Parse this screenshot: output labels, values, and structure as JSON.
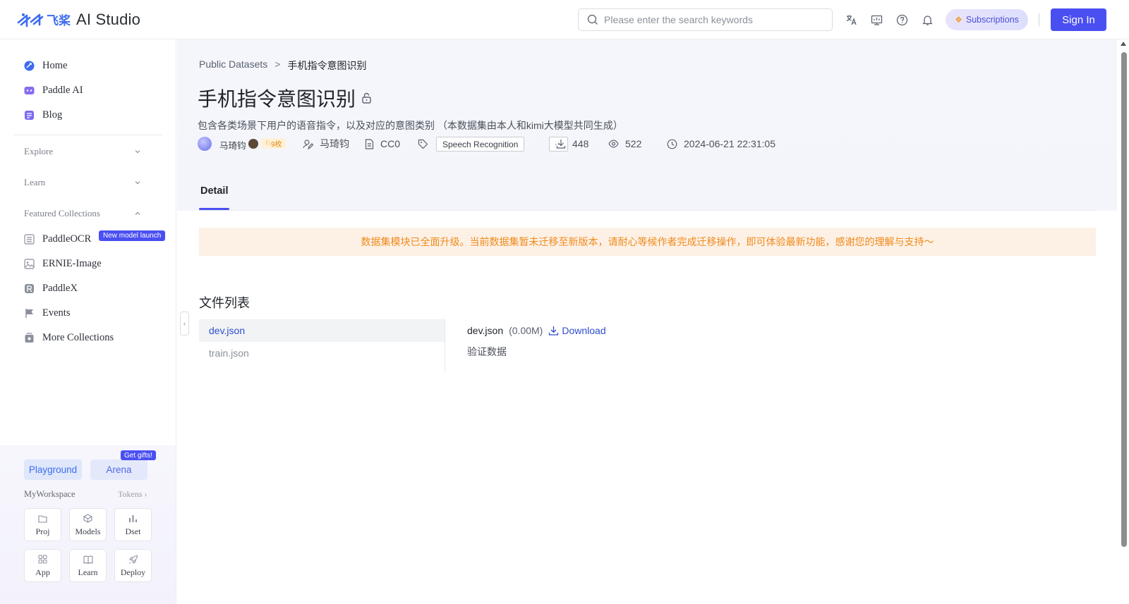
{
  "header": {
    "logo_text": "AI Studio",
    "logo_cn": "飞桨",
    "search_placeholder": "Please enter the search keywords",
    "icons": [
      "translate-icon",
      "monitor-icon",
      "help-icon",
      "bell-icon"
    ],
    "subscriptions_label": "Subscriptions",
    "signin_label": "Sign In"
  },
  "sidebar": {
    "items": [
      {
        "label": "Home",
        "icon": "home-icon",
        "color": "#3d6cf0"
      },
      {
        "label": "Paddle AI",
        "icon": "paddle-ai-icon",
        "color": "#8b6cf0"
      },
      {
        "label": "Blog",
        "icon": "blog-icon",
        "color": "#7a6cf0"
      }
    ],
    "sections": [
      {
        "label": "Explore",
        "expanded": false
      },
      {
        "label": "Learn",
        "expanded": false
      },
      {
        "label": "Featured Collections",
        "expanded": true
      }
    ],
    "collections": [
      {
        "label": "PaddleOCR",
        "icon": "ocr-icon",
        "badge": "New model launch"
      },
      {
        "label": "ERNIE-Image",
        "icon": "image-icon"
      },
      {
        "label": "PaddleX",
        "icon": "paddlex-icon"
      },
      {
        "label": "Events",
        "icon": "flag-icon"
      },
      {
        "label": "More Collections",
        "icon": "collections-icon"
      }
    ],
    "bottom": {
      "playground_label": "Playground",
      "arena_label": "Arena",
      "gifts_label": "Get gifts!",
      "workspace_title": "MyWorkspace",
      "tokens_label": "Tokens",
      "tiles": [
        {
          "label": "Proj",
          "icon": "folder-icon"
        },
        {
          "label": "Models",
          "icon": "cube-icon"
        },
        {
          "label": "Dset",
          "icon": "dataset-icon"
        },
        {
          "label": "App",
          "icon": "apps-icon"
        },
        {
          "label": "Learn",
          "icon": "book-icon"
        },
        {
          "label": "Deploy",
          "icon": "rocket-icon"
        }
      ]
    }
  },
  "main": {
    "breadcrumb": {
      "parent": "Public Datasets",
      "separator": ">",
      "current": "手机指令意图识别"
    },
    "title": "手机指令意图识别",
    "description": "包含各类场景下用户的语音指令，以及对应的意图类别 （本数据集由本人和kimi大模型共同生成）",
    "meta": {
      "author": "马琦钧",
      "medal": "9枚",
      "contributor": "马琦钧",
      "license": "CC0",
      "tag": "Speech Recognition",
      "tag_more": "···",
      "downloads": "448",
      "views": "522",
      "updated": "2024-06-21 22:31:05"
    },
    "tab_label": "Detail",
    "notice": "数据集模块已全面升级。当前数据集暂未迁移至新版本，请耐心等候作者完成迁移操作，即可体验最新功能，感谢您的理解与支持～",
    "file_list_title": "文件列表",
    "files": [
      {
        "name": "dev.json",
        "active": true
      },
      {
        "name": "train.json",
        "active": false
      }
    ],
    "selected_file": {
      "name": "dev.json",
      "size": "(0.00M)",
      "download_label": "Download",
      "description": "验证数据"
    }
  },
  "colors": {
    "accent": "#4a4ff2",
    "link": "#2d4ecf",
    "notice": "#f08a1c",
    "notice_bg": "#fdf1e6"
  }
}
